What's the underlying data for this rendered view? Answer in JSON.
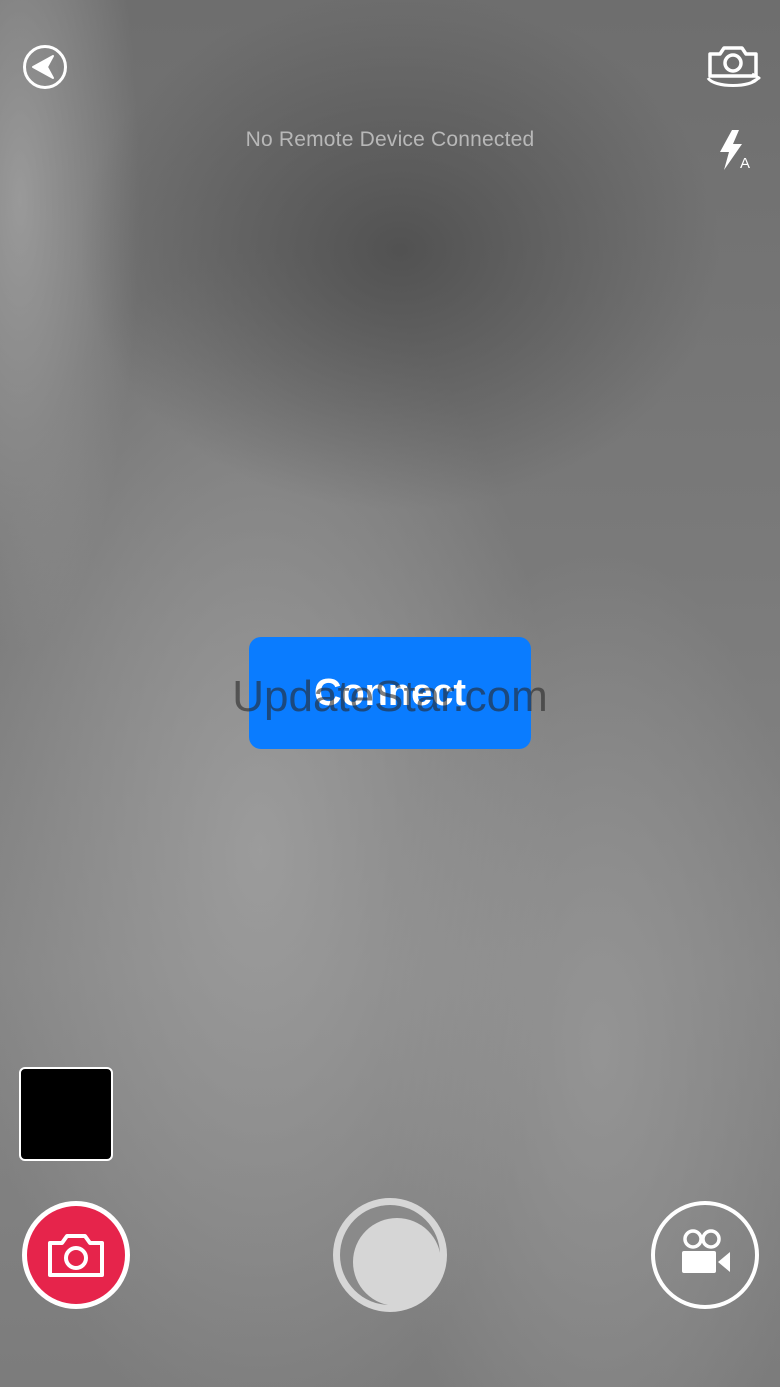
{
  "header": {
    "status": "No Remote Device Connected",
    "flash_mode_label": "A"
  },
  "main": {
    "connect_label": "Connect",
    "watermark": "UpdateStar.com"
  },
  "icons": {
    "back": "back-arrow-icon",
    "switch_camera": "switch-camera-icon",
    "flash": "flash-auto-icon",
    "photo_mode": "camera-icon",
    "video_mode": "video-camera-icon"
  },
  "colors": {
    "accent": "#0a7cff",
    "photo_mode_active": "#e6244b",
    "status_text": "#b8b8b8"
  }
}
